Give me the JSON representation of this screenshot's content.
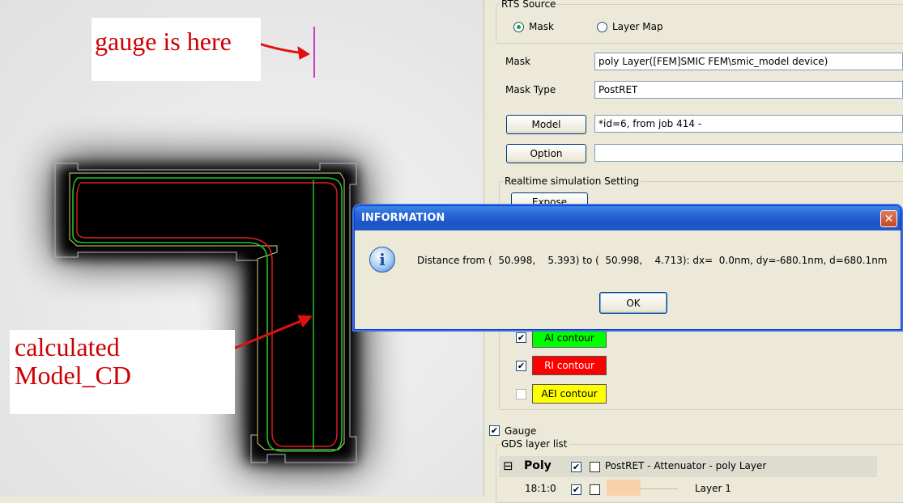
{
  "canvas": {
    "note_gauge": "gauge is here",
    "note_model_line1": "calculated",
    "note_model_line2": "Model_CD"
  },
  "panel": {
    "rts_source": {
      "legend": "RTS Source",
      "options": [
        {
          "label": "Mask",
          "selected": true
        },
        {
          "label": "Layer Map",
          "selected": false
        }
      ]
    },
    "mask_label": "Mask",
    "mask_value": "poly Layer([FEM]SMIC FEM\\smic_model device)",
    "mask_type_label": "Mask Type",
    "mask_type_value": "PostRET",
    "model_button": "Model",
    "model_value": "*id=6, from job 414 -",
    "option_button": "Option",
    "option_value": "",
    "realtime_legend": "Realtime simulation Setting",
    "expose_button": "Expose",
    "contours": [
      {
        "label": "AI contour",
        "checked": true,
        "color": "#00ff00"
      },
      {
        "label": "RI contour",
        "checked": true,
        "color": "#ff0000"
      },
      {
        "label": "AEI contour",
        "checked": false,
        "color": "#ffff00"
      }
    ],
    "gauge": {
      "label": "Gauge",
      "checked": true
    },
    "gds_legend": "GDS layer list",
    "layer_group": {
      "expander": "⊟",
      "name": "Poly",
      "description": "PostRET - Attenuator - poly Layer"
    },
    "layer_row": {
      "id": "18:1:0",
      "name": "Layer 1"
    }
  },
  "dialog": {
    "title": "INFORMATION",
    "close_glyph": "✕",
    "icon_glyph": "i",
    "message": "Distance from (  50.998,    5.393) to (  50.998,    4.713): dx=  0.0nm, dy=-680.1nm, d=680.1nm",
    "ok_label": "OK"
  },
  "colors": {
    "ai_contour": "#00ff00",
    "ri_contour": "#ff0000",
    "aei_contour": "#ffff00",
    "gauge_line": "#c000c0",
    "annotation_red": "#cc0000"
  }
}
